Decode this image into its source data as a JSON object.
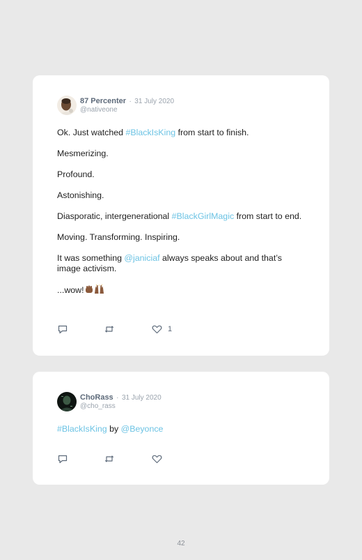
{
  "tweets": [
    {
      "name": "87 Percenter",
      "separator": "·",
      "date": "31 July 2020",
      "handle": "@nativeone",
      "p1_a": "Ok. Just watched ",
      "p1_link": "#BlackIsKing",
      "p1_b": " from start to finish.",
      "p2": "Mesmerizing.",
      "p3": "Profound.",
      "p4": "Astonishing.",
      "p5_a": "Diasporatic, intergenerational ",
      "p5_link": "#BlackGirlMagic",
      "p5_b": " from start to end.",
      "p6": "Moving. Transforming. Inspiring.",
      "p7_a": "It was something ",
      "p7_link": "@janiciaf",
      "p7_b": " always speaks about and that’s image activism.",
      "p8": "...wow!",
      "likes": "1",
      "icons": [
        "reply-icon",
        "retweet-icon",
        "heart-icon"
      ]
    },
    {
      "name": "ChoRass",
      "separator": "·",
      "date": "31 July 2020",
      "handle": "@cho_rass",
      "link1": "#BlackIsKing",
      "mid": " by ",
      "link2": "@Beyonce",
      "icons": [
        "reply-icon",
        "retweet-icon",
        "heart-icon"
      ]
    }
  ],
  "page_number": "42",
  "colors": {
    "background": "#e9e9e9",
    "card": "#ffffff",
    "link": "#6cc3e4",
    "name": "#5d6a7a",
    "muted": "#9aa3ad"
  }
}
